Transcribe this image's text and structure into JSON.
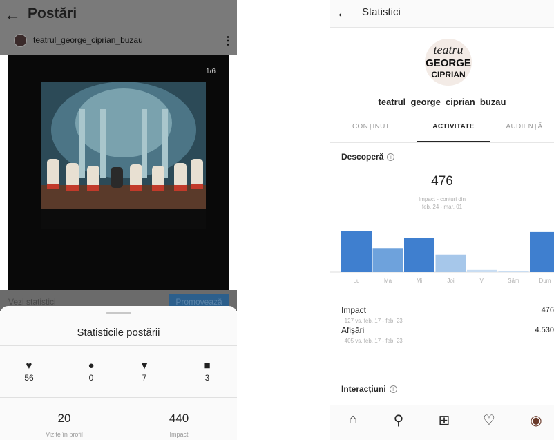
{
  "left": {
    "back_glyph": "←",
    "title": "Postări",
    "account": "teatrul_george_ciprian_buzau",
    "more_glyph": "⋮",
    "photo_counter": "1/6",
    "view_insights": "Vezi statistici",
    "promote": "Promovează",
    "sheet": {
      "title": "Statisticile postării",
      "interactions": [
        {
          "icon": "heart-icon",
          "glyph": "♥",
          "value": "56"
        },
        {
          "icon": "comment-icon",
          "glyph": "●",
          "value": "0"
        },
        {
          "icon": "share-icon",
          "glyph": "▼",
          "value": "7"
        },
        {
          "icon": "bookmark-icon",
          "glyph": "■",
          "value": "3"
        }
      ],
      "profile_visits": {
        "value": "20",
        "label": "Vizite în profil"
      },
      "reach": {
        "value": "440",
        "label": "Impact"
      }
    }
  },
  "right": {
    "back_glyph": "←",
    "title": "Statistici",
    "logo_lines": [
      "teatru",
      "GEORGE",
      "CIPRIAN"
    ],
    "account": "teatrul_george_ciprian_buzau",
    "tabs": [
      {
        "label": "CONȚINUT",
        "active": false
      },
      {
        "label": "ACTIVITATE",
        "active": true
      },
      {
        "label": "AUDIENȚĂ",
        "active": false
      }
    ],
    "discover": {
      "title": "Descoperă",
      "info_glyph": "i",
      "value": "476",
      "subtitle_1": "Impact - conturi din",
      "subtitle_2": "feb. 24 - mar. 01"
    },
    "chart_data": {
      "type": "bar",
      "categories": [
        "Lu",
        "Ma",
        "Mi",
        "Joi",
        "Vi",
        "Sâm",
        "Dum"
      ],
      "values": [
        95,
        55,
        78,
        40,
        5,
        1,
        92
      ],
      "colors": [
        "#3f7fcf",
        "#6ea2dc",
        "#3f7fcf",
        "#a6c7ea",
        "#c9ddf2",
        "#c9ddf2",
        "#3f7fcf"
      ]
    },
    "metrics": [
      {
        "label": "Impact",
        "sub": "+127 vs. feb. 17 - feb. 23",
        "value": "476"
      },
      {
        "label": "Afișări",
        "sub": "+405 vs. feb. 17 - feb. 23",
        "value": "4.530"
      }
    ],
    "interactions": {
      "title": "Interacțiuni",
      "info_glyph": "i"
    },
    "nav": [
      {
        "icon": "home-icon",
        "glyph": "⌂"
      },
      {
        "icon": "search-icon",
        "glyph": "⚲"
      },
      {
        "icon": "add-post-icon",
        "glyph": "⊞"
      },
      {
        "icon": "activity-heart-icon",
        "glyph": "♡"
      },
      {
        "icon": "profile-avatar-icon",
        "glyph": "◉"
      }
    ]
  }
}
